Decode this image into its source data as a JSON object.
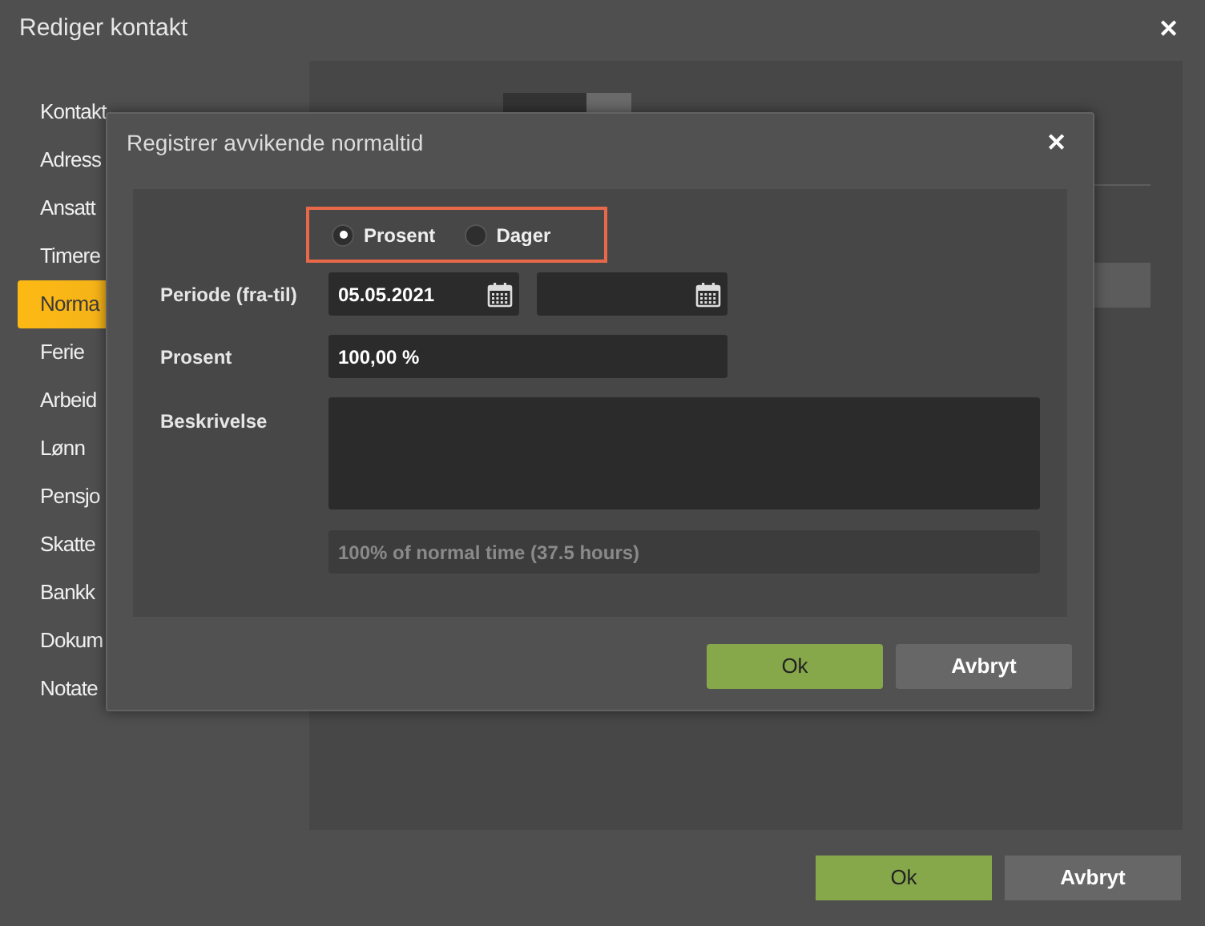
{
  "window": {
    "title": "Rediger kontakt",
    "close": "✕"
  },
  "sidebar": {
    "items": [
      {
        "label": "Kontakt",
        "selected": false
      },
      {
        "label": "Adress",
        "selected": false
      },
      {
        "label": "Ansatt",
        "selected": false
      },
      {
        "label": "Timere",
        "selected": false
      },
      {
        "label": "Norma",
        "selected": true
      },
      {
        "label": "Ferie",
        "selected": false
      },
      {
        "label": "Arbeid",
        "selected": false
      },
      {
        "label": "Lønn",
        "selected": false
      },
      {
        "label": "Pensjo",
        "selected": false
      },
      {
        "label": "Skatte",
        "selected": false
      },
      {
        "label": "Bankk",
        "selected": false
      },
      {
        "label": "Dokum",
        "selected": false
      },
      {
        "label": "Notate",
        "selected": false
      }
    ]
  },
  "dialog": {
    "title": "Registrer avvikende normaltid",
    "close": "✕",
    "radios": [
      {
        "label": "Prosent",
        "selected": true
      },
      {
        "label": "Dager",
        "selected": false
      }
    ],
    "period_label": "Periode (fra-til)",
    "period_from": "05.05.2021",
    "percent_label": "Prosent",
    "percent_value": "100,00 %",
    "description_label": "Beskrivelse",
    "info": "100% of normal time (37.5 hours)",
    "buttons": [
      "Ok",
      "Avbryt"
    ]
  },
  "buttons": [
    "Ok",
    "Avbryt"
  ]
}
